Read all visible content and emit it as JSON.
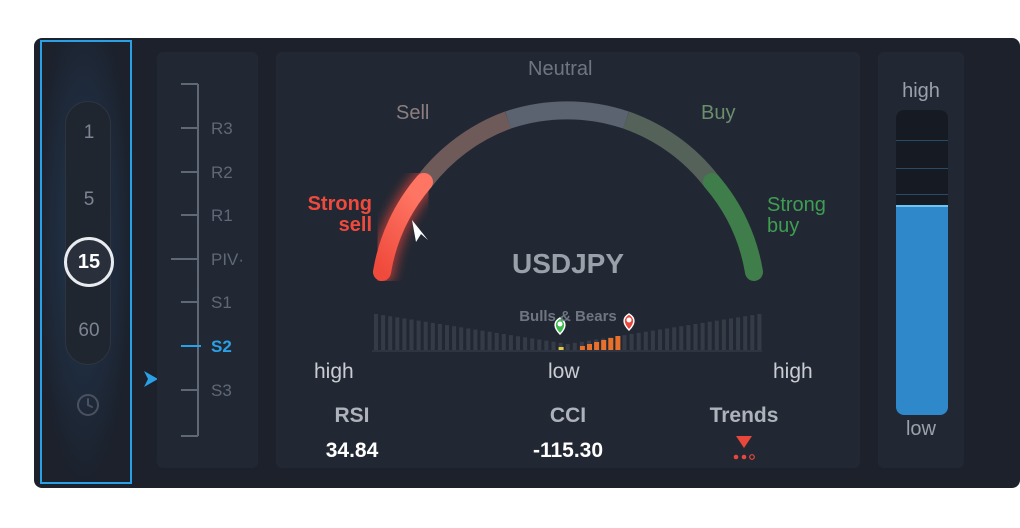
{
  "timeframes": {
    "items": [
      "1",
      "5",
      "15",
      "60"
    ],
    "selected": "15"
  },
  "pivot_levels": [
    {
      "label": "R3",
      "active": false
    },
    {
      "label": "R2",
      "active": false
    },
    {
      "label": "R1",
      "active": false
    },
    {
      "label": "PIV·",
      "active": false
    },
    {
      "label": "S1",
      "active": false
    },
    {
      "label": "S2",
      "active": true
    },
    {
      "label": "S3",
      "active": false
    }
  ],
  "gauge": {
    "labels": {
      "neutral": "Neutral",
      "sell": "Sell",
      "buy": "Buy",
      "strong_sell_1": "Strong",
      "strong_sell_2": "sell",
      "strong_buy_1": "Strong",
      "strong_buy_2": "buy"
    },
    "reading": "Strong sell",
    "symbol": "USDJPY",
    "colors": {
      "strong_sell": "#ef4a3c",
      "sell": "#8a8e97",
      "neutral": "#6f7682",
      "buy": "#3f9e53",
      "strong_buy": "#3f9e53"
    }
  },
  "bulls_bears": {
    "title": "Bulls & Bears",
    "left_label": "high",
    "center_label": "low",
    "right_label": "high",
    "bull_marker_color": "#3fb950",
    "bear_marker_color": "#e8473c",
    "bar_color": "#e8702a"
  },
  "indicators": {
    "rsi": {
      "label": "RSI",
      "value": "34.84"
    },
    "cci": {
      "label": "CCI",
      "value": "-115.30"
    },
    "trends": {
      "label": "Trends",
      "icon": "down-trend-icon",
      "color": "#e8473c"
    }
  },
  "volume_bar": {
    "top_label": "high",
    "bottom_label": "low",
    "level_fraction": 0.69,
    "color": "#2e88c9"
  }
}
